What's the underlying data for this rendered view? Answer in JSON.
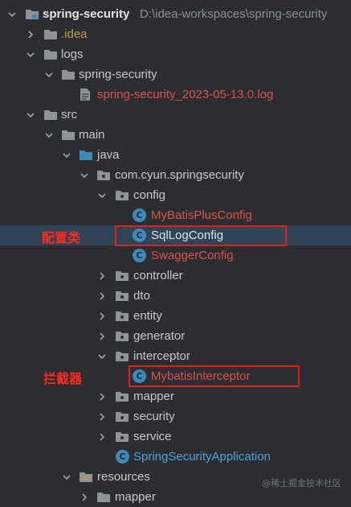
{
  "project": {
    "name": "spring-security",
    "path": "D:\\idea-workspaces\\spring-security"
  },
  "tree": {
    "idea": ".idea",
    "logs": "logs",
    "logs_spring_security": "spring-security",
    "log_file": "spring-security_2023-05-13.0.log",
    "src": "src",
    "main": "main",
    "java": "java",
    "package": "com.cyun.springsecurity",
    "config": "config",
    "mybatis_plus_config": "MyBatisPlusConfig",
    "sql_log_config": "SqlLogConfig",
    "swagger_config": "SwaggerConfig",
    "controller": "controller",
    "dto": "dto",
    "entity": "entity",
    "generator": "generator",
    "interceptor": "interceptor",
    "mybatis_interceptor": "MybatisInterceptor",
    "mapper": "mapper",
    "security": "security",
    "service": "service",
    "app": "SpringSecurityApplication",
    "resources": "resources",
    "res_mapper": "mapper"
  },
  "annotations": {
    "config_label": "配置类",
    "interceptor_label": "拦截器"
  },
  "watermark": "@稀土掘金技术社区",
  "colors": {
    "background": "#2b2d30",
    "selection": "#2f4456",
    "highlight_box": "#e0201b",
    "changed_file": "#d9524e"
  }
}
